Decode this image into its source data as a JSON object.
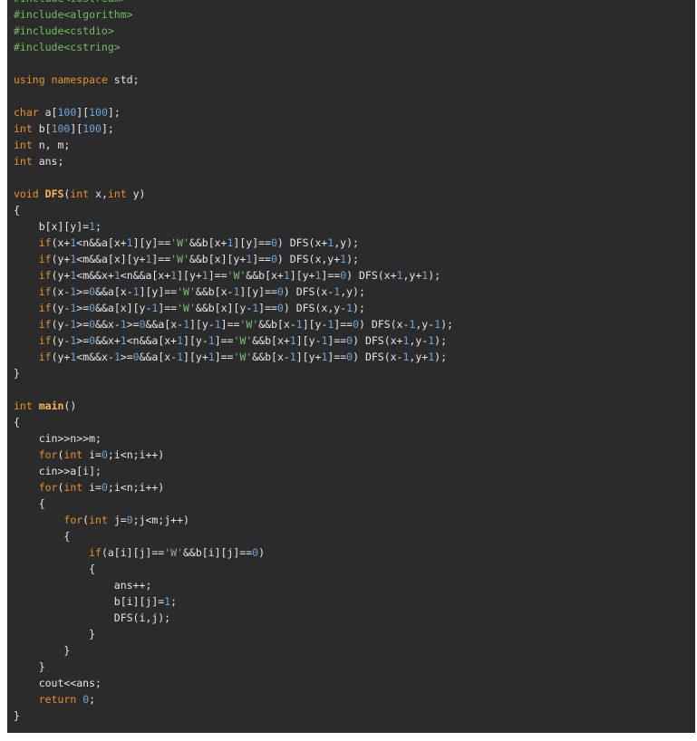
{
  "editor": {
    "language": "C++",
    "lines": [
      [
        {
          "t": "#include<iostream>",
          "c": "pp"
        }
      ],
      [
        {
          "t": "#include<algorithm>",
          "c": "pp"
        }
      ],
      [
        {
          "t": "#include<cstdio>",
          "c": "pp"
        }
      ],
      [
        {
          "t": "#include<cstring>",
          "c": "pp"
        }
      ],
      [],
      [
        {
          "t": "using",
          "c": "kw"
        },
        {
          "t": " ",
          "c": "txt"
        },
        {
          "t": "namespace",
          "c": "kw"
        },
        {
          "t": " std;",
          "c": "txt"
        }
      ],
      [],
      [
        {
          "t": "char",
          "c": "typ"
        },
        {
          "t": " a[",
          "c": "txt"
        },
        {
          "t": "100",
          "c": "num"
        },
        {
          "t": "][",
          "c": "txt"
        },
        {
          "t": "100",
          "c": "num"
        },
        {
          "t": "];",
          "c": "txt"
        }
      ],
      [
        {
          "t": "int",
          "c": "typ"
        },
        {
          "t": " b[",
          "c": "txt"
        },
        {
          "t": "100",
          "c": "num"
        },
        {
          "t": "][",
          "c": "txt"
        },
        {
          "t": "100",
          "c": "num"
        },
        {
          "t": "];",
          "c": "txt"
        }
      ],
      [
        {
          "t": "int",
          "c": "typ"
        },
        {
          "t": " n, m;",
          "c": "txt"
        }
      ],
      [
        {
          "t": "int",
          "c": "typ"
        },
        {
          "t": " ans;",
          "c": "txt"
        }
      ],
      [],
      [
        {
          "t": "void",
          "c": "typ"
        },
        {
          "t": " ",
          "c": "txt"
        },
        {
          "t": "DFS",
          "c": "fn"
        },
        {
          "t": "(",
          "c": "txt"
        },
        {
          "t": "int",
          "c": "typ"
        },
        {
          "t": " x,",
          "c": "txt"
        },
        {
          "t": "int",
          "c": "typ"
        },
        {
          "t": " y)",
          "c": "txt"
        }
      ],
      [
        {
          "t": "{",
          "c": "txt"
        }
      ],
      [
        {
          "t": "    b[x][y]=",
          "c": "txt"
        },
        {
          "t": "1",
          "c": "num"
        },
        {
          "t": ";",
          "c": "txt"
        }
      ],
      [
        {
          "t": "    ",
          "c": "txt"
        },
        {
          "t": "if",
          "c": "kw"
        },
        {
          "t": "(x+",
          "c": "txt"
        },
        {
          "t": "1",
          "c": "num"
        },
        {
          "t": "<n&&a[x+",
          "c": "txt"
        },
        {
          "t": "1",
          "c": "num"
        },
        {
          "t": "][y]==",
          "c": "txt"
        },
        {
          "t": "'W'",
          "c": "str"
        },
        {
          "t": "&&b[x+",
          "c": "txt"
        },
        {
          "t": "1",
          "c": "num"
        },
        {
          "t": "][y]==",
          "c": "txt"
        },
        {
          "t": "0",
          "c": "num"
        },
        {
          "t": ") DFS(x+",
          "c": "txt"
        },
        {
          "t": "1",
          "c": "num"
        },
        {
          "t": ",y);",
          "c": "txt"
        }
      ],
      [
        {
          "t": "    ",
          "c": "txt"
        },
        {
          "t": "if",
          "c": "kw"
        },
        {
          "t": "(y+",
          "c": "txt"
        },
        {
          "t": "1",
          "c": "num"
        },
        {
          "t": "<m&&a[x][y+",
          "c": "txt"
        },
        {
          "t": "1",
          "c": "num"
        },
        {
          "t": "]==",
          "c": "txt"
        },
        {
          "t": "'W'",
          "c": "str"
        },
        {
          "t": "&&b[x][y+",
          "c": "txt"
        },
        {
          "t": "1",
          "c": "num"
        },
        {
          "t": "]==",
          "c": "txt"
        },
        {
          "t": "0",
          "c": "num"
        },
        {
          "t": ") DFS(x,y+",
          "c": "txt"
        },
        {
          "t": "1",
          "c": "num"
        },
        {
          "t": ");",
          "c": "txt"
        }
      ],
      [
        {
          "t": "    ",
          "c": "txt"
        },
        {
          "t": "if",
          "c": "kw"
        },
        {
          "t": "(y+",
          "c": "txt"
        },
        {
          "t": "1",
          "c": "num"
        },
        {
          "t": "<m&&x+",
          "c": "txt"
        },
        {
          "t": "1",
          "c": "num"
        },
        {
          "t": "<n&&a[x+",
          "c": "txt"
        },
        {
          "t": "1",
          "c": "num"
        },
        {
          "t": "][y+",
          "c": "txt"
        },
        {
          "t": "1",
          "c": "num"
        },
        {
          "t": "]==",
          "c": "txt"
        },
        {
          "t": "'W'",
          "c": "str"
        },
        {
          "t": "&&b[x+",
          "c": "txt"
        },
        {
          "t": "1",
          "c": "num"
        },
        {
          "t": "][y+",
          "c": "txt"
        },
        {
          "t": "1",
          "c": "num"
        },
        {
          "t": "]==",
          "c": "txt"
        },
        {
          "t": "0",
          "c": "num"
        },
        {
          "t": ") DFS(x+",
          "c": "txt"
        },
        {
          "t": "1",
          "c": "num"
        },
        {
          "t": ",y+",
          "c": "txt"
        },
        {
          "t": "1",
          "c": "num"
        },
        {
          "t": ");",
          "c": "txt"
        }
      ],
      [
        {
          "t": "    ",
          "c": "txt"
        },
        {
          "t": "if",
          "c": "kw"
        },
        {
          "t": "(x-",
          "c": "txt"
        },
        {
          "t": "1",
          "c": "num"
        },
        {
          "t": ">=",
          "c": "txt"
        },
        {
          "t": "0",
          "c": "num"
        },
        {
          "t": "&&a[x-",
          "c": "txt"
        },
        {
          "t": "1",
          "c": "num"
        },
        {
          "t": "][y]==",
          "c": "txt"
        },
        {
          "t": "'W'",
          "c": "str"
        },
        {
          "t": "&&b[x-",
          "c": "txt"
        },
        {
          "t": "1",
          "c": "num"
        },
        {
          "t": "][y]==",
          "c": "txt"
        },
        {
          "t": "0",
          "c": "num"
        },
        {
          "t": ") DFS(x-",
          "c": "txt"
        },
        {
          "t": "1",
          "c": "num"
        },
        {
          "t": ",y);",
          "c": "txt"
        }
      ],
      [
        {
          "t": "    ",
          "c": "txt"
        },
        {
          "t": "if",
          "c": "kw"
        },
        {
          "t": "(y-",
          "c": "txt"
        },
        {
          "t": "1",
          "c": "num"
        },
        {
          "t": ">=",
          "c": "txt"
        },
        {
          "t": "0",
          "c": "num"
        },
        {
          "t": "&&a[x][y-",
          "c": "txt"
        },
        {
          "t": "1",
          "c": "num"
        },
        {
          "t": "]==",
          "c": "txt"
        },
        {
          "t": "'W'",
          "c": "str"
        },
        {
          "t": "&&b[x][y-",
          "c": "txt"
        },
        {
          "t": "1",
          "c": "num"
        },
        {
          "t": "]==",
          "c": "txt"
        },
        {
          "t": "0",
          "c": "num"
        },
        {
          "t": ") DFS(x,y-",
          "c": "txt"
        },
        {
          "t": "1",
          "c": "num"
        },
        {
          "t": ");",
          "c": "txt"
        }
      ],
      [
        {
          "t": "    ",
          "c": "txt"
        },
        {
          "t": "if",
          "c": "kw"
        },
        {
          "t": "(y-",
          "c": "txt"
        },
        {
          "t": "1",
          "c": "num"
        },
        {
          "t": ">=",
          "c": "txt"
        },
        {
          "t": "0",
          "c": "num"
        },
        {
          "t": "&&x-",
          "c": "txt"
        },
        {
          "t": "1",
          "c": "num"
        },
        {
          "t": ">=",
          "c": "txt"
        },
        {
          "t": "0",
          "c": "num"
        },
        {
          "t": "&&a[x-",
          "c": "txt"
        },
        {
          "t": "1",
          "c": "num"
        },
        {
          "t": "][y-",
          "c": "txt"
        },
        {
          "t": "1",
          "c": "num"
        },
        {
          "t": "]==",
          "c": "txt"
        },
        {
          "t": "'W'",
          "c": "str"
        },
        {
          "t": "&&b[x-",
          "c": "txt"
        },
        {
          "t": "1",
          "c": "num"
        },
        {
          "t": "][y-",
          "c": "txt"
        },
        {
          "t": "1",
          "c": "num"
        },
        {
          "t": "]==",
          "c": "txt"
        },
        {
          "t": "0",
          "c": "num"
        },
        {
          "t": ") DFS(x-",
          "c": "txt"
        },
        {
          "t": "1",
          "c": "num"
        },
        {
          "t": ",y-",
          "c": "txt"
        },
        {
          "t": "1",
          "c": "num"
        },
        {
          "t": ");",
          "c": "txt"
        }
      ],
      [
        {
          "t": "    ",
          "c": "txt"
        },
        {
          "t": "if",
          "c": "kw"
        },
        {
          "t": "(y-",
          "c": "txt"
        },
        {
          "t": "1",
          "c": "num"
        },
        {
          "t": ">=",
          "c": "txt"
        },
        {
          "t": "0",
          "c": "num"
        },
        {
          "t": "&&x+",
          "c": "txt"
        },
        {
          "t": "1",
          "c": "num"
        },
        {
          "t": "<n&&a[x+",
          "c": "txt"
        },
        {
          "t": "1",
          "c": "num"
        },
        {
          "t": "][y-",
          "c": "txt"
        },
        {
          "t": "1",
          "c": "num"
        },
        {
          "t": "]==",
          "c": "txt"
        },
        {
          "t": "'W'",
          "c": "str"
        },
        {
          "t": "&&b[x+",
          "c": "txt"
        },
        {
          "t": "1",
          "c": "num"
        },
        {
          "t": "][y-",
          "c": "txt"
        },
        {
          "t": "1",
          "c": "num"
        },
        {
          "t": "]==",
          "c": "txt"
        },
        {
          "t": "0",
          "c": "num"
        },
        {
          "t": ") DFS(x+",
          "c": "txt"
        },
        {
          "t": "1",
          "c": "num"
        },
        {
          "t": ",y-",
          "c": "txt"
        },
        {
          "t": "1",
          "c": "num"
        },
        {
          "t": ");",
          "c": "txt"
        }
      ],
      [
        {
          "t": "    ",
          "c": "txt"
        },
        {
          "t": "if",
          "c": "kw"
        },
        {
          "t": "(y+",
          "c": "txt"
        },
        {
          "t": "1",
          "c": "num"
        },
        {
          "t": "<m&&x-",
          "c": "txt"
        },
        {
          "t": "1",
          "c": "num"
        },
        {
          "t": ">=",
          "c": "txt"
        },
        {
          "t": "0",
          "c": "num"
        },
        {
          "t": "&&a[x-",
          "c": "txt"
        },
        {
          "t": "1",
          "c": "num"
        },
        {
          "t": "][y+",
          "c": "txt"
        },
        {
          "t": "1",
          "c": "num"
        },
        {
          "t": "]==",
          "c": "txt"
        },
        {
          "t": "'W'",
          "c": "str"
        },
        {
          "t": "&&b[x-",
          "c": "txt"
        },
        {
          "t": "1",
          "c": "num"
        },
        {
          "t": "][y+",
          "c": "txt"
        },
        {
          "t": "1",
          "c": "num"
        },
        {
          "t": "]==",
          "c": "txt"
        },
        {
          "t": "0",
          "c": "num"
        },
        {
          "t": ") DFS(x-",
          "c": "txt"
        },
        {
          "t": "1",
          "c": "num"
        },
        {
          "t": ",y+",
          "c": "txt"
        },
        {
          "t": "1",
          "c": "num"
        },
        {
          "t": ");",
          "c": "txt"
        }
      ],
      [
        {
          "t": "}",
          "c": "txt"
        }
      ],
      [],
      [
        {
          "t": "int",
          "c": "typ"
        },
        {
          "t": " ",
          "c": "txt"
        },
        {
          "t": "main",
          "c": "fn"
        },
        {
          "t": "()",
          "c": "txt"
        }
      ],
      [
        {
          "t": "{",
          "c": "txt"
        }
      ],
      [
        {
          "t": "    cin>>n>>m;",
          "c": "txt"
        }
      ],
      [
        {
          "t": "    ",
          "c": "txt"
        },
        {
          "t": "for",
          "c": "kw"
        },
        {
          "t": "(",
          "c": "txt"
        },
        {
          "t": "int",
          "c": "typ"
        },
        {
          "t": " i=",
          "c": "txt"
        },
        {
          "t": "0",
          "c": "num"
        },
        {
          "t": ";i<n;i++)",
          "c": "txt"
        }
      ],
      [
        {
          "t": "    cin>>a[i];",
          "c": "txt"
        }
      ],
      [
        {
          "t": "    ",
          "c": "txt"
        },
        {
          "t": "for",
          "c": "kw"
        },
        {
          "t": "(",
          "c": "txt"
        },
        {
          "t": "int",
          "c": "typ"
        },
        {
          "t": " i=",
          "c": "txt"
        },
        {
          "t": "0",
          "c": "num"
        },
        {
          "t": ";i<n;i++)",
          "c": "txt"
        }
      ],
      [
        {
          "t": "    {",
          "c": "txt"
        }
      ],
      [
        {
          "t": "        ",
          "c": "txt"
        },
        {
          "t": "for",
          "c": "kw"
        },
        {
          "t": "(",
          "c": "txt"
        },
        {
          "t": "int",
          "c": "typ"
        },
        {
          "t": " j=",
          "c": "txt"
        },
        {
          "t": "0",
          "c": "num"
        },
        {
          "t": ";j<m;j++)",
          "c": "txt"
        }
      ],
      [
        {
          "t": "        {",
          "c": "txt"
        }
      ],
      [
        {
          "t": "            ",
          "c": "txt"
        },
        {
          "t": "if",
          "c": "kw"
        },
        {
          "t": "(a[i][j]==",
          "c": "txt"
        },
        {
          "t": "'W'",
          "c": "str"
        },
        {
          "t": "&&b[i][j]==",
          "c": "txt"
        },
        {
          "t": "0",
          "c": "num"
        },
        {
          "t": ")",
          "c": "txt"
        }
      ],
      [
        {
          "t": "            {",
          "c": "txt"
        }
      ],
      [
        {
          "t": "                ans++;",
          "c": "txt"
        }
      ],
      [
        {
          "t": "                b[i][j]=",
          "c": "txt"
        },
        {
          "t": "1",
          "c": "num"
        },
        {
          "t": ";",
          "c": "txt"
        }
      ],
      [
        {
          "t": "                DFS(i,j);",
          "c": "txt"
        }
      ],
      [
        {
          "t": "            }",
          "c": "txt"
        }
      ],
      [
        {
          "t": "        }",
          "c": "txt"
        }
      ],
      [
        {
          "t": "    }",
          "c": "txt"
        }
      ],
      [
        {
          "t": "    cout<<ans;",
          "c": "txt"
        }
      ],
      [
        {
          "t": "    ",
          "c": "txt"
        },
        {
          "t": "return",
          "c": "kw"
        },
        {
          "t": " ",
          "c": "txt"
        },
        {
          "t": "0",
          "c": "num"
        },
        {
          "t": ";",
          "c": "txt"
        }
      ],
      [
        {
          "t": "}",
          "c": "txt"
        }
      ]
    ]
  }
}
